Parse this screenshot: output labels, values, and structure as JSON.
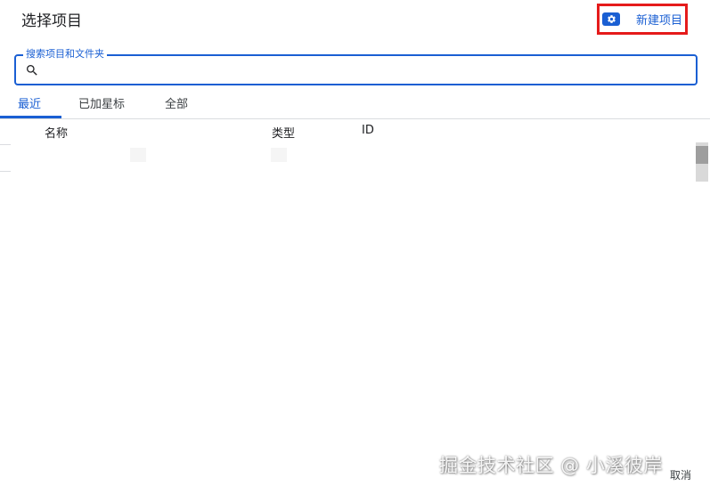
{
  "dialog": {
    "title": "选择项目",
    "new_project_label": "新建项目",
    "new_project_icon": "gear-icon",
    "accent_color": "#1a5fd3",
    "highlight_color": "#e51b1b"
  },
  "search": {
    "label": "搜索项目和文件夹",
    "value": "",
    "icon": "search-icon"
  },
  "tabs": [
    {
      "label": "最近",
      "active": true
    },
    {
      "label": "已加星标",
      "active": false
    },
    {
      "label": "全部",
      "active": false
    }
  ],
  "table": {
    "columns": [
      "名称",
      "类型",
      "ID"
    ]
  },
  "footer": {
    "cancel_label": "取消"
  },
  "watermark": "掘金技术社区 @ 小溪彼岸"
}
